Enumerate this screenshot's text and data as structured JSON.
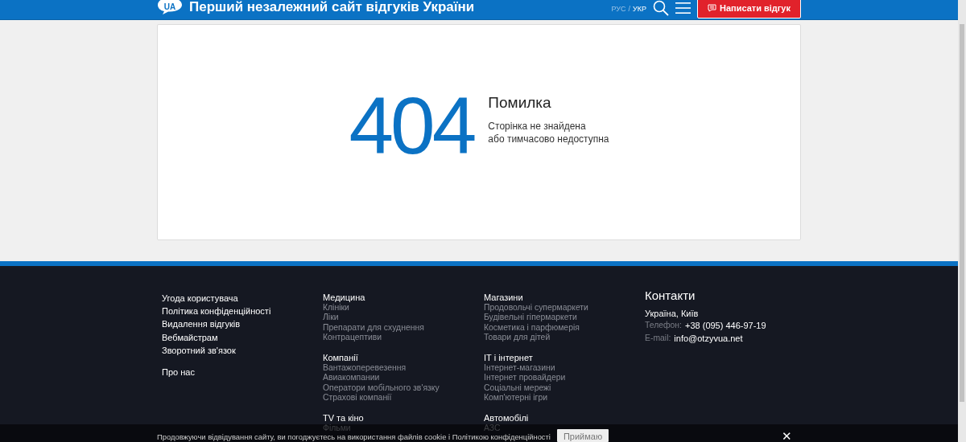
{
  "header": {
    "logo": "UA",
    "title": "Перший незалежний сайт відгуків України",
    "languages": [
      {
        "label": "РУС",
        "selected": false
      },
      {
        "label": "УКР",
        "selected": true
      }
    ],
    "separator": "/",
    "write_button": "Написати відгук"
  },
  "error": {
    "code": "404",
    "title": "Помилка",
    "lines": [
      "Сторінка не знайдена",
      "або тимчасово недоступна"
    ]
  },
  "footer": {
    "link_groups": [
      [
        "Угода користувача",
        "Політика конфіденційності",
        "Видалення відгуків",
        "Вебмайстрам",
        "Зворотний зв'язок"
      ],
      [
        "Про нас"
      ]
    ],
    "categories": [
      [
        {
          "title": "Медицина",
          "items": [
            "Клініки",
            "Ліки",
            "Препарати для схуднення",
            "Контрацептиви"
          ]
        },
        {
          "title": "Компанії",
          "items": [
            "Вантажоперевезення",
            "Авиакомпании",
            "Оператори мобільного зв'язку",
            "Страхові компанії"
          ]
        },
        {
          "title": "TV та кіно",
          "items": [
            "Фільми"
          ]
        }
      ],
      [
        {
          "title": "Магазини",
          "items": [
            "Продовольчі супермаркети",
            "Будівельні гіпермаркети",
            "Косметика і парфюмерія",
            "Товари для дітей"
          ]
        },
        {
          "title": "IT і інтернет",
          "items": [
            "Інтернет-магазини",
            "Інтернет провайдери",
            "Соціальні мережі",
            "Комп'ютерні ігри"
          ]
        },
        {
          "title": "Автомобілі",
          "items": [
            "АЗС"
          ]
        }
      ]
    ],
    "contacts": {
      "title": "Контакти",
      "city": "Україна, Київ",
      "rows": [
        {
          "label": "Телефон:",
          "value": "+38 (095) 446-97-19"
        },
        {
          "label": "E-mail:",
          "value": "info@otzyvua.net"
        }
      ]
    }
  },
  "cookie": {
    "text": "Продовжуючи відвідування сайту, ви погоджуєтесь на використання файлів cookie і Політикою конфіденційності",
    "button": "Приймаю",
    "close": "✕"
  }
}
